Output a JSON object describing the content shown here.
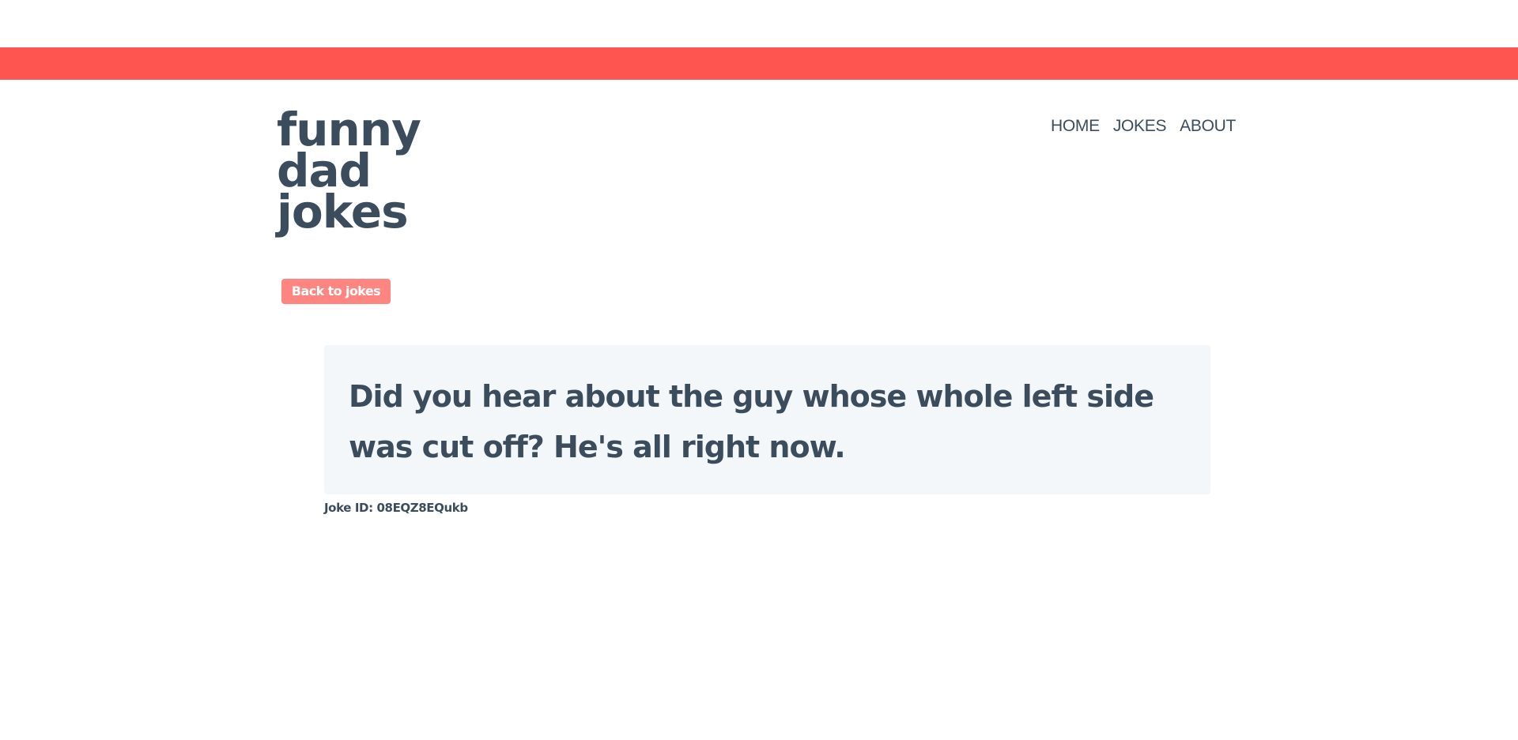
{
  "logo": {
    "line1": "funny",
    "line2": "dad",
    "line3": "jokes"
  },
  "nav": {
    "home": "HOME",
    "jokes": "JOKES",
    "about": "ABOUT"
  },
  "back_button": {
    "label": "Back to jokes"
  },
  "joke": {
    "text": "Did you hear about the guy whose whole left side was cut off? He's all right now.",
    "id_label": "Joke ID: 08EQZ8EQukb"
  },
  "colors": {
    "accent": "#ff5551",
    "button": "#ff8580",
    "text": "#3b4c5c",
    "card": "#f4f7fa"
  }
}
